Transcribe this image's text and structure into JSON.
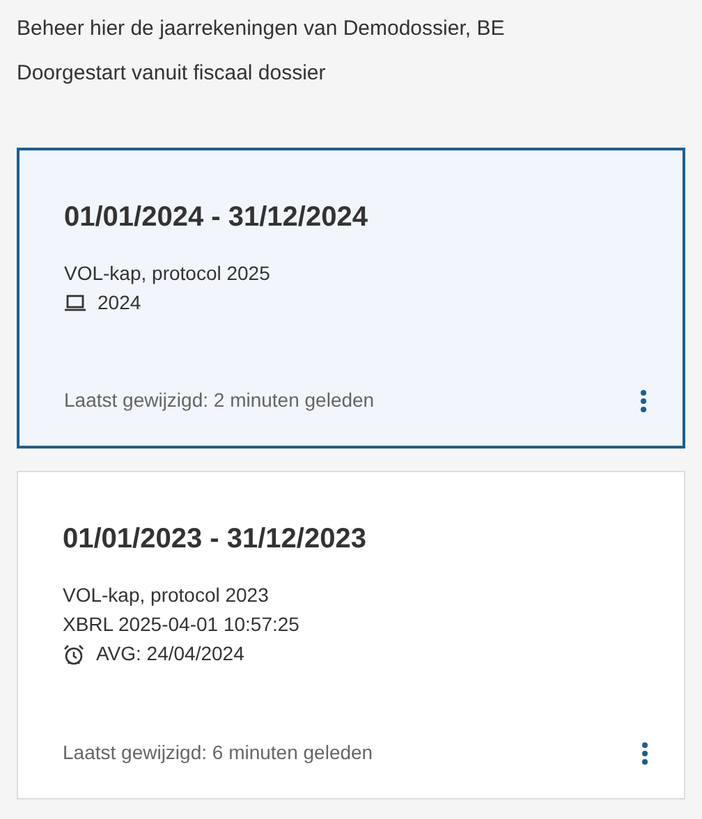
{
  "intro": [
    "Beheer hier de jaarrekeningen van Demodossier, BE",
    "Doorgestart vanuit fiscaal dossier"
  ],
  "cards": [
    {
      "title": "01/01/2024 - 31/12/2024",
      "selected": true,
      "lines": [
        {
          "kind": "text",
          "text": "VOL-kap, protocol 2025"
        },
        {
          "kind": "device",
          "text": "2024"
        }
      ],
      "modified": "Laatst gewijzigd: 2 minuten geleden"
    },
    {
      "title": "01/01/2023 - 31/12/2023",
      "selected": false,
      "lines": [
        {
          "kind": "text",
          "text": "VOL-kap, protocol 2023"
        },
        {
          "kind": "text",
          "text": "XBRL 2025-04-01 10:57:25"
        },
        {
          "kind": "reminder",
          "text": "AVG: 24/04/2024"
        }
      ],
      "modified": "Laatst gewijzigd: 6 minuten geleden"
    }
  ]
}
